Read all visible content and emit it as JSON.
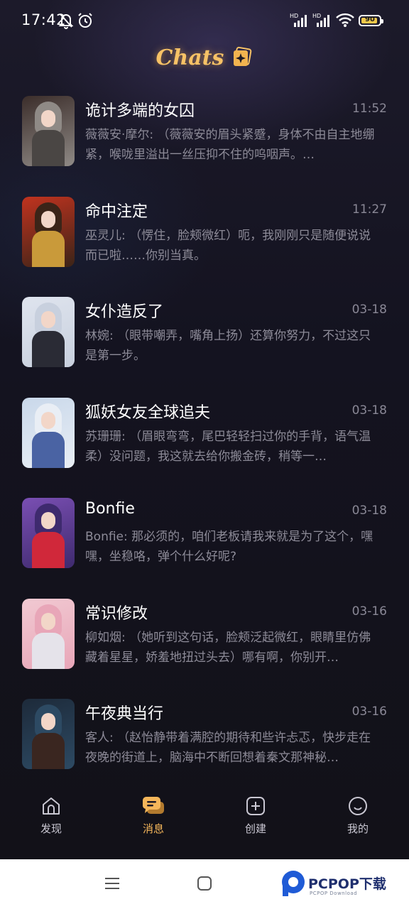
{
  "status_bar": {
    "time": "17:42",
    "battery": "90",
    "battery_level": 0.9
  },
  "header": {
    "title": "Chats",
    "title_icon": "sparkle-card-icon"
  },
  "chats": [
    {
      "name": "诡计多端的女囚",
      "time": "11:52",
      "preview": "薇薇安·摩尔: （薇薇安的眉头紧蹙，身体不由自主地绷紧，喉咙里溢出一丝压抑不住的呜咽声。…",
      "avatar_colors": [
        "#3b2d2a",
        "#8f8a86",
        "#4a4644"
      ]
    },
    {
      "name": "命中注定",
      "time": "11:27",
      "preview": "巫灵儿: （愣住，脸颊微红）呃，我刚刚只是随便说说而已啦……你别当真。",
      "avatar_colors": [
        "#c1331f",
        "#3b2418",
        "#c99a3a"
      ]
    },
    {
      "name": "女仆造反了",
      "time": "03-18",
      "preview": "林婉: （眼带嘲弄，嘴角上扬）还算你努力，不过这只是第一步。",
      "avatar_colors": [
        "#dfe4ee",
        "#c8d0de",
        "#2a2b35"
      ]
    },
    {
      "name": "狐妖女友全球追夫",
      "time": "03-18",
      "preview": "苏珊珊: （眉眼弯弯，尾巴轻轻扫过你的手背，语气温柔）没问题，我这就去给你搬金砖，稍等一…",
      "avatar_colors": [
        "#c9d8ea",
        "#e9eef5",
        "#4a63a3"
      ]
    },
    {
      "name": "Bonfie",
      "time": "03-18",
      "preview": "Bonfie: 那必须的，咱们老板请我来就是为了这个，嘿嘿，坐稳咯，弹个什么好呢?",
      "avatar_colors": [
        "#7a4fb3",
        "#3e2a6e",
        "#d0283a"
      ]
    },
    {
      "name": "常识修改",
      "time": "03-16",
      "preview": "柳如烟: （她听到这句话，脸颊泛起微红，眼睛里仿佛藏着星星，娇羞地扭过头去）哪有啊，你别开…",
      "avatar_colors": [
        "#f1c9d2",
        "#e8a6b8",
        "#e5e3ea"
      ]
    },
    {
      "name": "午夜典当行",
      "time": "03-16",
      "preview": "客人: （赵怡静带着满腔的期待和些许忐忑，快步走在夜晚的街道上，脑海中不断回想着秦文那神秘…",
      "avatar_colors": [
        "#1d2a3a",
        "#2d4a63",
        "#3a2620"
      ]
    }
  ],
  "bottom_nav": [
    {
      "label": "发现",
      "icon": "home-icon",
      "active": false
    },
    {
      "label": "消息",
      "icon": "chat-bubble-icon",
      "active": true
    },
    {
      "label": "创建",
      "icon": "plus-square-icon",
      "active": false
    },
    {
      "label": "我的",
      "icon": "smile-profile-icon",
      "active": false
    }
  ],
  "watermark": {
    "text": "PCPOP下载",
    "sub": "PCPOP Download"
  },
  "colors": {
    "accent": "#f5b65a",
    "background": "#14121a",
    "muted_text": "#8d8b98"
  }
}
